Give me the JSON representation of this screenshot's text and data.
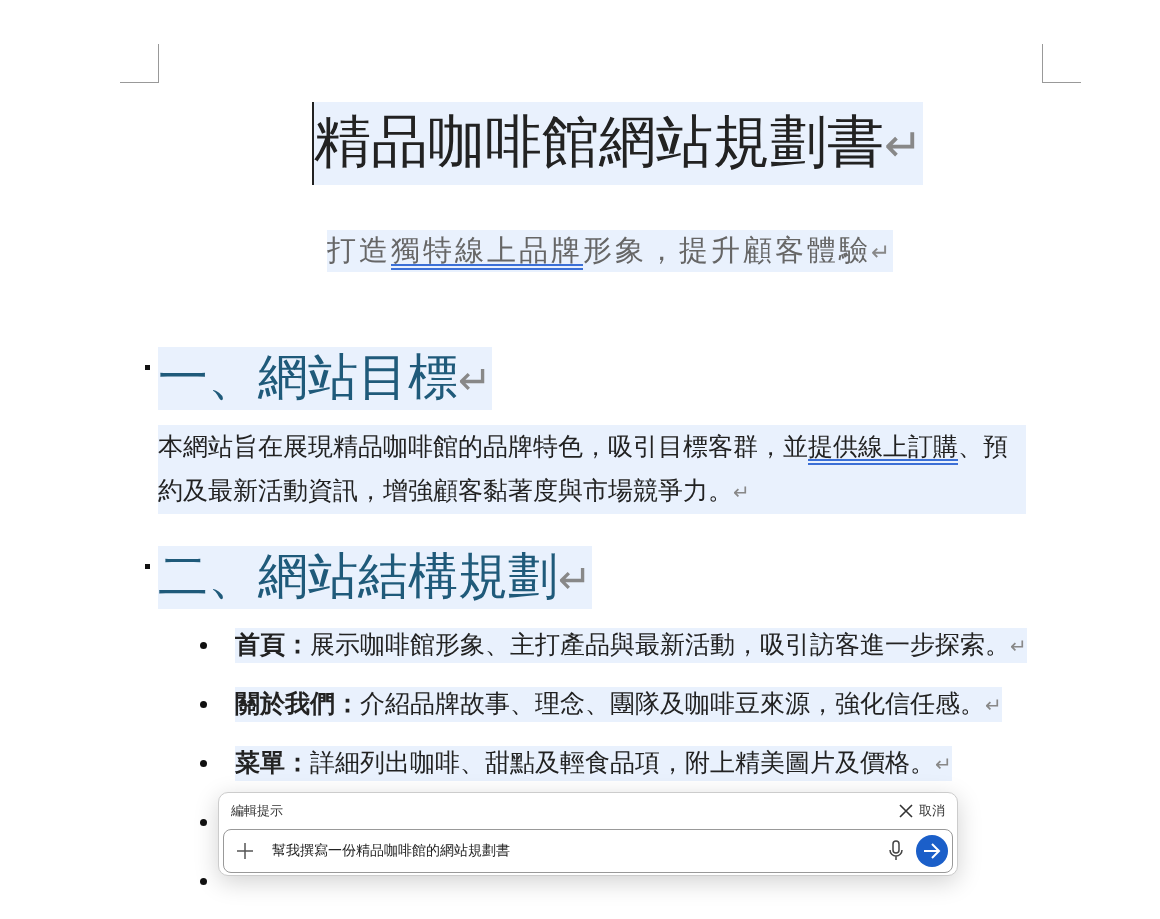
{
  "document": {
    "title": {
      "text": "精品咖啡館網站規劃書",
      "mark": "↵"
    },
    "subtitle": {
      "segments": [
        {
          "text": "打造",
          "underline": false
        },
        {
          "text": "獨特線上品牌",
          "underline": true
        },
        {
          "text": "形象，提升顧客體驗",
          "underline": false
        }
      ],
      "mark": "↵"
    },
    "sections": [
      {
        "heading": "一、網站目標",
        "mark": "↵",
        "paragraph": {
          "segments": [
            {
              "text": "本網站旨在展現精品咖啡館的品牌特色，吸引目標客群，並",
              "underline": false
            },
            {
              "text": "提供線上訂購",
              "underline": true
            },
            {
              "text": "、預約及最新活動資訊，增強顧客黏著度與市場競爭力。",
              "underline": false
            }
          ],
          "mark": "↵"
        }
      },
      {
        "heading": "二、網站結構規劃",
        "mark": "↵",
        "bullets": [
          {
            "kind": "text",
            "term": "首頁：",
            "text": "展示咖啡館形象、主打產品與最新活動，吸引訪客進一步探索。",
            "mark": "↵"
          },
          {
            "kind": "text",
            "term": "關於我們：",
            "text": "介紹品牌故事、理念、團隊及咖啡豆來源，強化信任感。",
            "mark": "↵"
          },
          {
            "kind": "text",
            "term": "菜單：",
            "text": "詳細列出咖啡、甜點及輕食品項，附上精美圖片及價格。",
            "mark": "↵"
          },
          {
            "kind": "covered"
          },
          {
            "kind": "covered"
          }
        ]
      }
    ]
  },
  "prompt_panel": {
    "title": "編輯提示",
    "cancel": "取消",
    "prompt": "幫我撰寫一份精品咖啡館的網站規劃書"
  }
}
